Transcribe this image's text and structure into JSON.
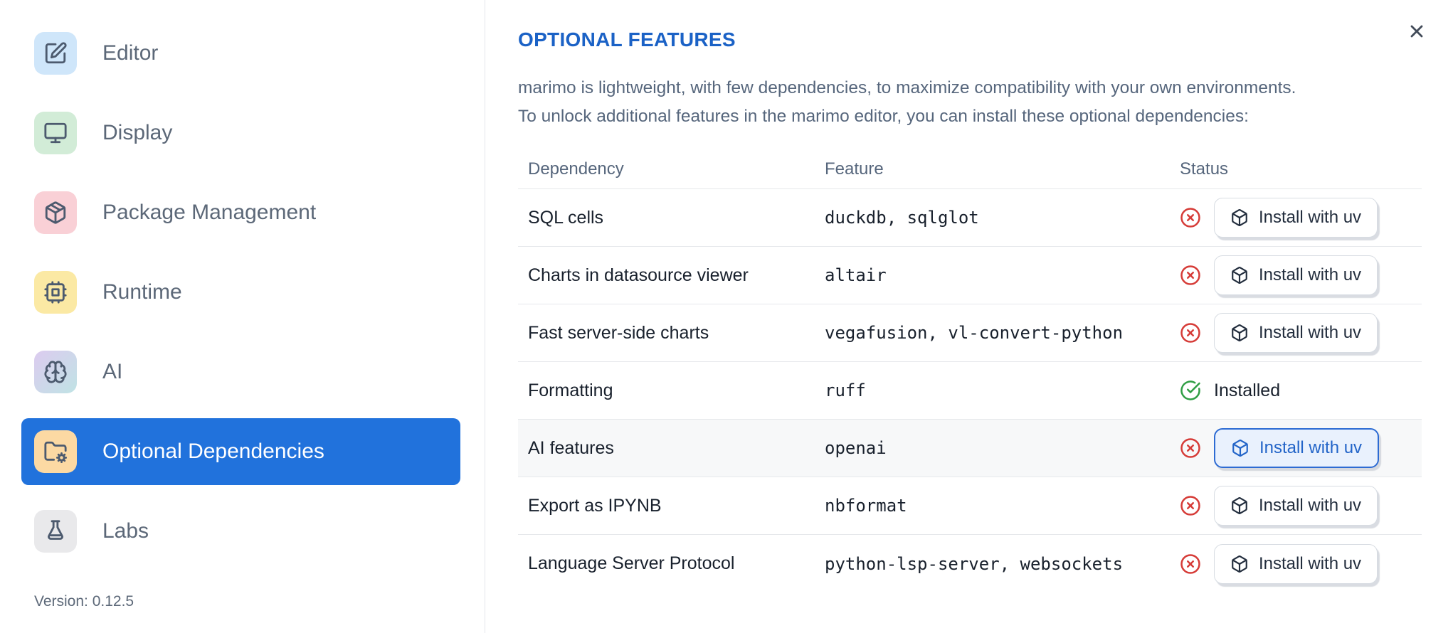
{
  "sidebar": {
    "items": [
      {
        "label": "Editor",
        "icon": "square-pen-icon",
        "icon_bg": "#cfe6fa"
      },
      {
        "label": "Display",
        "icon": "monitor-icon",
        "icon_bg": "#d2ecd7"
      },
      {
        "label": "Package Management",
        "icon": "package-icon",
        "icon_bg": "#f9d0d6"
      },
      {
        "label": "Runtime",
        "icon": "cpu-icon",
        "icon_bg": "#fbe9a4"
      },
      {
        "label": "AI",
        "icon": "brain-icon",
        "icon_bg": "#dccbef",
        "icon_bg2": "#c0e3e5"
      },
      {
        "label": "Optional Dependencies",
        "icon": "folder-cog-icon",
        "icon_bg": "#fcd9a3",
        "selected": true
      },
      {
        "label": "Labs",
        "icon": "flask-icon",
        "icon_bg": "#e9e9eb"
      }
    ],
    "version_label": "Version: 0.12.5"
  },
  "dialog": {
    "title": "OPTIONAL FEATURES",
    "description_line1": "marimo is lightweight, with few dependencies, to maximize compatibility with your own environments.",
    "description_line2": "To unlock additional features in the marimo editor, you can install these optional dependencies:"
  },
  "table": {
    "columns": [
      "Dependency",
      "Feature",
      "Status"
    ],
    "rows": [
      {
        "dependency": "SQL cells",
        "feature": "duckdb, sqlglot",
        "installed": false,
        "status_icon": "circle-x-icon",
        "action_label": "Install with uv"
      },
      {
        "dependency": "Charts in datasource viewer",
        "feature": "altair",
        "installed": false,
        "status_icon": "circle-x-icon",
        "action_label": "Install with uv"
      },
      {
        "dependency": "Fast server-side charts",
        "feature": "vegafusion, vl-convert-python",
        "installed": false,
        "status_icon": "circle-x-icon",
        "action_label": "Install with uv"
      },
      {
        "dependency": "Formatting",
        "feature": "ruff",
        "installed": true,
        "status_icon": "circle-check-icon",
        "status_label": "Installed"
      },
      {
        "dependency": "AI features",
        "feature": "openai",
        "installed": false,
        "status_icon": "circle-x-icon",
        "action_label": "Install with uv",
        "highlighted": true
      },
      {
        "dependency": "Export as IPYNB",
        "feature": "nbformat",
        "installed": false,
        "status_icon": "circle-x-icon",
        "action_label": "Install with uv"
      },
      {
        "dependency": "Language Server Protocol",
        "feature": "python-lsp-server, websockets",
        "installed": false,
        "status_icon": "circle-x-icon",
        "action_label": "Install with uv"
      }
    ]
  },
  "colors": {
    "sidebar_selected_blue": "#2172dc",
    "title_blue": "#1b62c6",
    "active_button_blue": "#2264c8",
    "status_red": "#d63c38",
    "status_green": "#2f9e44",
    "highlight_row": "#f7f8f9"
  }
}
